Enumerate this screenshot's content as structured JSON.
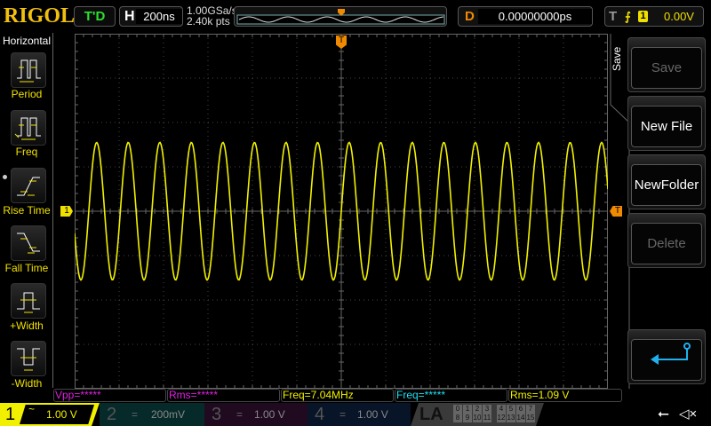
{
  "header": {
    "brand": "RIGOL",
    "run_status": "T'D",
    "horizontal_label": "H",
    "timebase": "200ns",
    "sample_rate": "1.00GSa/s",
    "memory_depth": "2.40k pts",
    "delay_label": "D",
    "delay": "0.00000000ps",
    "trigger_label": "T",
    "trigger_slope": "rising",
    "trigger_source": "1",
    "trigger_level": "0.00V"
  },
  "left_menu": {
    "title": "Horizontal",
    "items": [
      {
        "label": "Period"
      },
      {
        "label": "Freq"
      },
      {
        "label": "Rise Time"
      },
      {
        "label": "Fall Time"
      },
      {
        "label": "+Width"
      },
      {
        "label": "-Width"
      }
    ]
  },
  "right_menu": {
    "title": "Save",
    "items": [
      {
        "label": "Save",
        "enabled": false
      },
      {
        "label": "New File",
        "enabled": true
      },
      {
        "label": "NewFolder",
        "enabled": true
      },
      {
        "label": "Delete",
        "enabled": false
      }
    ],
    "back_icon": "return-arrow-icon"
  },
  "markers": {
    "ch1": "1",
    "trigger": "T"
  },
  "measurements": [
    {
      "text": "Vpp=*****",
      "color": "#e020e0"
    },
    {
      "text": "Rms=*****",
      "color": "#e020e0"
    },
    {
      "text": "Freq=7.04MHz",
      "color": "#f0f000"
    },
    {
      "text": "Freq=*****",
      "color": "#20e0f0"
    },
    {
      "text": "Rms=1.09 V",
      "color": "#f0f000"
    }
  ],
  "channels": [
    {
      "num": "1",
      "coupling": "~",
      "scale": "1.00 V",
      "active": true,
      "color": "#f0f000"
    },
    {
      "num": "2",
      "coupling": "=",
      "scale": "200mV",
      "active": false,
      "color": "#00a0a0"
    },
    {
      "num": "3",
      "coupling": "=",
      "scale": "1.00 V",
      "active": false,
      "color": "#c020c0"
    },
    {
      "num": "4",
      "coupling": "=",
      "scale": "1.00 V",
      "active": false,
      "color": "#2060c0"
    }
  ],
  "la": {
    "label": "LA",
    "bits_row1": [
      "0",
      "1",
      "2",
      "3",
      "4",
      "5",
      "6",
      "7"
    ],
    "bits_row2": [
      "8",
      "9",
      "10",
      "11",
      "12",
      "13",
      "14",
      "15"
    ]
  },
  "status_icons": [
    "usb-icon",
    "speaker-muted-icon"
  ],
  "waveform": {
    "channel": "1",
    "frequency_mhz": 7.04,
    "amplitude_v": 1.55,
    "offset_v": 0,
    "volts_per_div": 1,
    "time_per_div_ns": 200,
    "h_divs": 12,
    "v_divs": 8,
    "color": "#f0f000"
  }
}
